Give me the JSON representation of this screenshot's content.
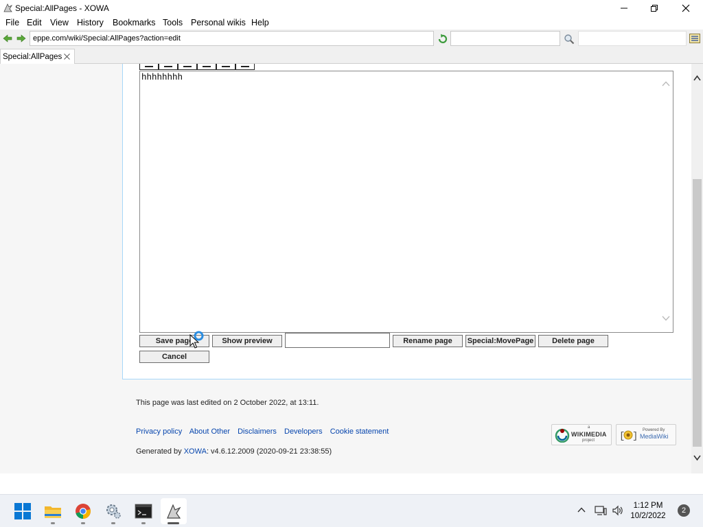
{
  "window": {
    "title": "Special:AllPages - XOWA"
  },
  "menu": {
    "items": [
      "File",
      "Edit",
      "View",
      "History",
      "Bookmarks",
      "Tools",
      "Personal wikis",
      "Help"
    ]
  },
  "navbar": {
    "url": "eppe.com/wiki/Special:AllPages?action=edit",
    "search_value": "",
    "find_value": ""
  },
  "tabs": [
    {
      "label": "Special:AllPages"
    }
  ],
  "editor": {
    "text": "hhhhhhhh"
  },
  "buttons": {
    "save": "Save page",
    "preview": "Show preview",
    "rename": "Rename page",
    "move": "Special:MovePage",
    "delete": "Delete page",
    "cancel": "Cancel"
  },
  "summary": {
    "value": ""
  },
  "footer": {
    "last_edited": "This page was last edited on 2 October 2022, at 13:11.",
    "links": [
      "Privacy policy",
      "About Other",
      "Disclaimers",
      "Developers",
      "Cookie statement"
    ],
    "generated_prefix": "Generated by ",
    "generated_link": "XOWA",
    "generated_suffix": ": v4.6.12.2009 (2020-09-21 23:38:55)"
  },
  "badges": {
    "wikimedia": {
      "small": "a",
      "name": "WIKIMEDIA",
      "sub": "project"
    },
    "mediawiki": {
      "small": "Powered By",
      "name": "MediaWiki"
    }
  },
  "taskbar": {
    "time": "1:12 PM",
    "date": "10/2/2022",
    "notifications": "2"
  },
  "colors": {
    "link": "#0645ad",
    "article_border": "#a7d7f9",
    "go_arrow": "#3a9a3a",
    "nav_arrow": "#4a9a2a"
  }
}
